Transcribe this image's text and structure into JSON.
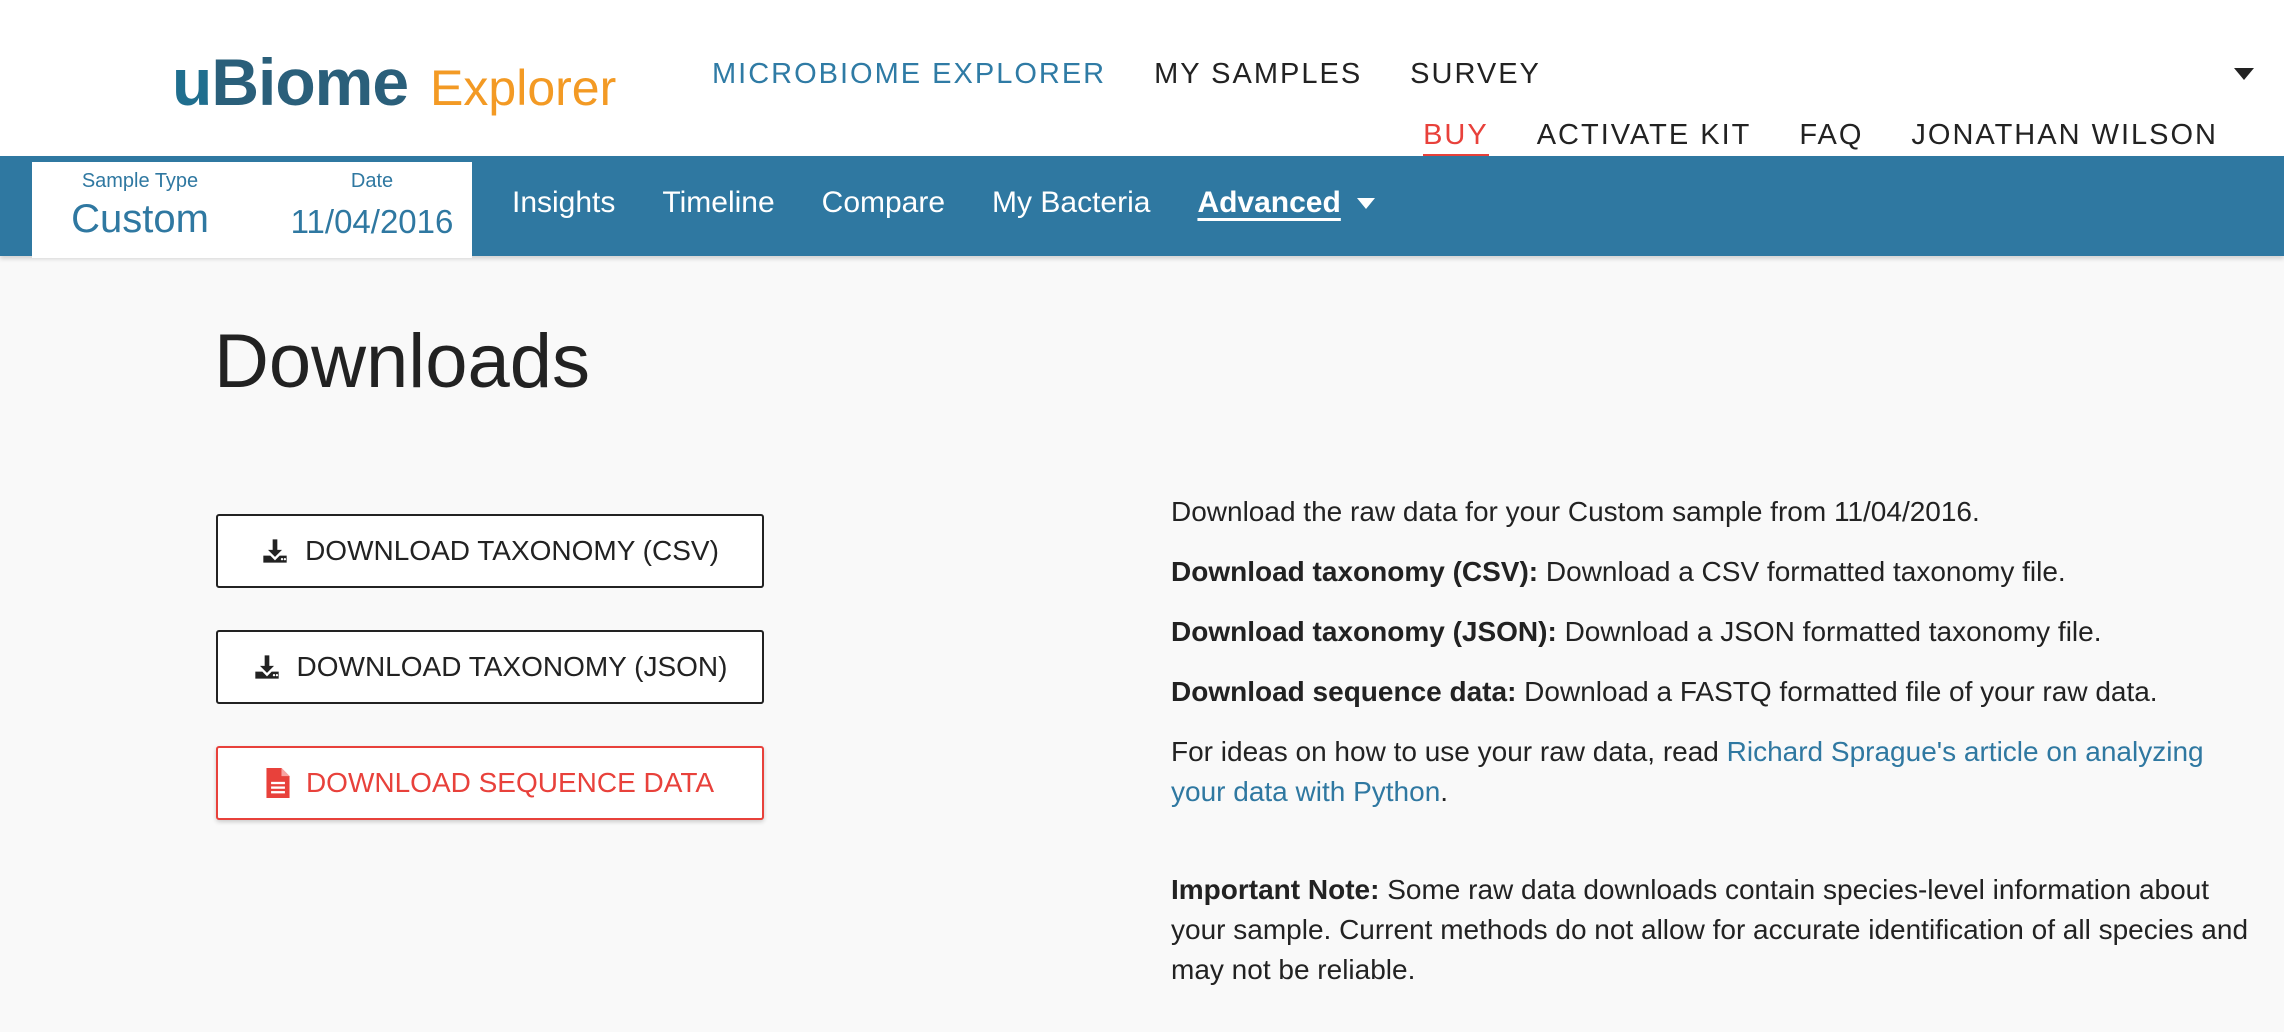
{
  "brand": {
    "logo_u": "u",
    "logo_biome": "Biome",
    "logo_explorer": "Explorer",
    "colors": {
      "primary_blue": "#2f78a1",
      "logo_blue": "#2a5f7a",
      "orange": "#f39a24",
      "red": "#e8413b"
    }
  },
  "main_nav": [
    {
      "label": "MICROBIOME EXPLORER",
      "active": true
    },
    {
      "label": "MY SAMPLES",
      "active": false
    },
    {
      "label": "SURVEY",
      "active": false
    }
  ],
  "sub_nav": [
    {
      "label": "BUY"
    },
    {
      "label": "ACTIVATE KIT"
    },
    {
      "label": "FAQ"
    },
    {
      "label": "JONATHAN WILSON"
    }
  ],
  "sample_selector": {
    "type_label": "Sample Type",
    "type_value": "Custom",
    "date_label": "Date",
    "date_value": "11/04/2016"
  },
  "tabs": [
    {
      "label": "Insights"
    },
    {
      "label": "Timeline"
    },
    {
      "label": "Compare"
    },
    {
      "label": "My Bacteria"
    },
    {
      "label": "Advanced",
      "active": true
    }
  ],
  "page": {
    "title": "Downloads",
    "buttons": [
      {
        "label": "DOWNLOAD TAXONOMY (CSV)",
        "icon": "download-icon"
      },
      {
        "label": "DOWNLOAD TAXONOMY (JSON)",
        "icon": "download-icon"
      },
      {
        "label": "DOWNLOAD SEQUENCE DATA",
        "icon": "file-icon"
      }
    ],
    "intro": "Download the raw data for your Custom sample from 11/04/2016.",
    "items": [
      {
        "term": "Download taxonomy (CSV):",
        "text": " Download a CSV formatted taxonomy file."
      },
      {
        "term": "Download taxonomy (JSON):",
        "text": " Download a JSON formatted taxonomy file."
      },
      {
        "term": "Download sequence data:",
        "text": " Download a FASTQ formatted file of your raw data."
      }
    ],
    "ideas_prefix": "For ideas on how to use your raw data, read ",
    "ideas_link": "Richard Sprague's article on analyzing your data with Python",
    "ideas_suffix": ".",
    "note_term": "Important Note:",
    "note_text": " Some raw data downloads contain species-level information about your sample. Current methods do not allow for accurate identification of all species and may not be reliable."
  }
}
